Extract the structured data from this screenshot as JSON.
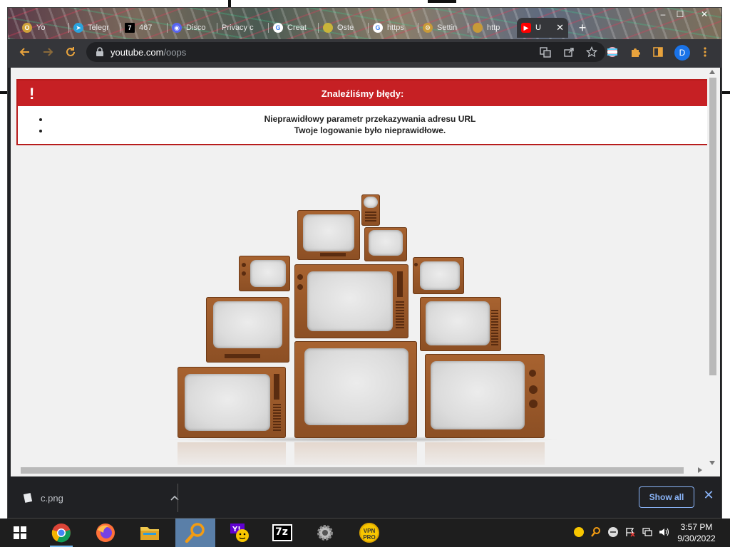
{
  "browser": {
    "tabs": [
      {
        "label": "Yo",
        "favicon": "opera-icon",
        "color": "#d0a23a"
      },
      {
        "label": "Telegr",
        "favicon": "telegram-icon",
        "color": "#2aa3de"
      },
      {
        "label": "467",
        "favicon": "seven-icon",
        "color": "#000000"
      },
      {
        "label": "Disco",
        "favicon": "discord-icon",
        "color": "#5865f2"
      },
      {
        "label": "Privacy c",
        "favicon": "",
        "color": ""
      },
      {
        "label": "Creat",
        "favicon": "google-icon",
        "color": "#ffffff"
      },
      {
        "label": "Oste",
        "favicon": "",
        "color": "#c9b43a"
      },
      {
        "label": "https",
        "favicon": "google-icon",
        "color": "#ffffff"
      },
      {
        "label": "Settin",
        "favicon": "gear-icon",
        "color": "#c89a38"
      },
      {
        "label": "http",
        "favicon": "",
        "color": "#c89a38"
      },
      {
        "label": "U",
        "favicon": "youtube-icon",
        "color": "#ff0000",
        "active": true
      }
    ],
    "new_tab": "+",
    "window_controls": {
      "minimize": "–",
      "maximize": "☐",
      "close": "✕"
    },
    "url_host": "youtube.com",
    "url_path": "/oops",
    "profile_initial": "D"
  },
  "page": {
    "error_icon": "!",
    "error_title": "Znaleźliśmy błędy:",
    "errors": [
      "Nieprawidłowy parametr przekazywania adresu URL",
      "Twoje logowanie było nieprawidłowe."
    ]
  },
  "downloads": {
    "file_name": "c.png",
    "show_all": "Show all",
    "close": "✕"
  },
  "taskbar": {
    "apps": [
      "windows-start",
      "chrome",
      "firefox",
      "file-explorer",
      "search-magnifier",
      "yahoo-messenger",
      "7zip",
      "settings-gear",
      "vpn-pro"
    ],
    "vpn_label": "VPN PRO",
    "sevenzip_label": "7z",
    "time": "3:57 PM",
    "date": "9/30/2022"
  }
}
